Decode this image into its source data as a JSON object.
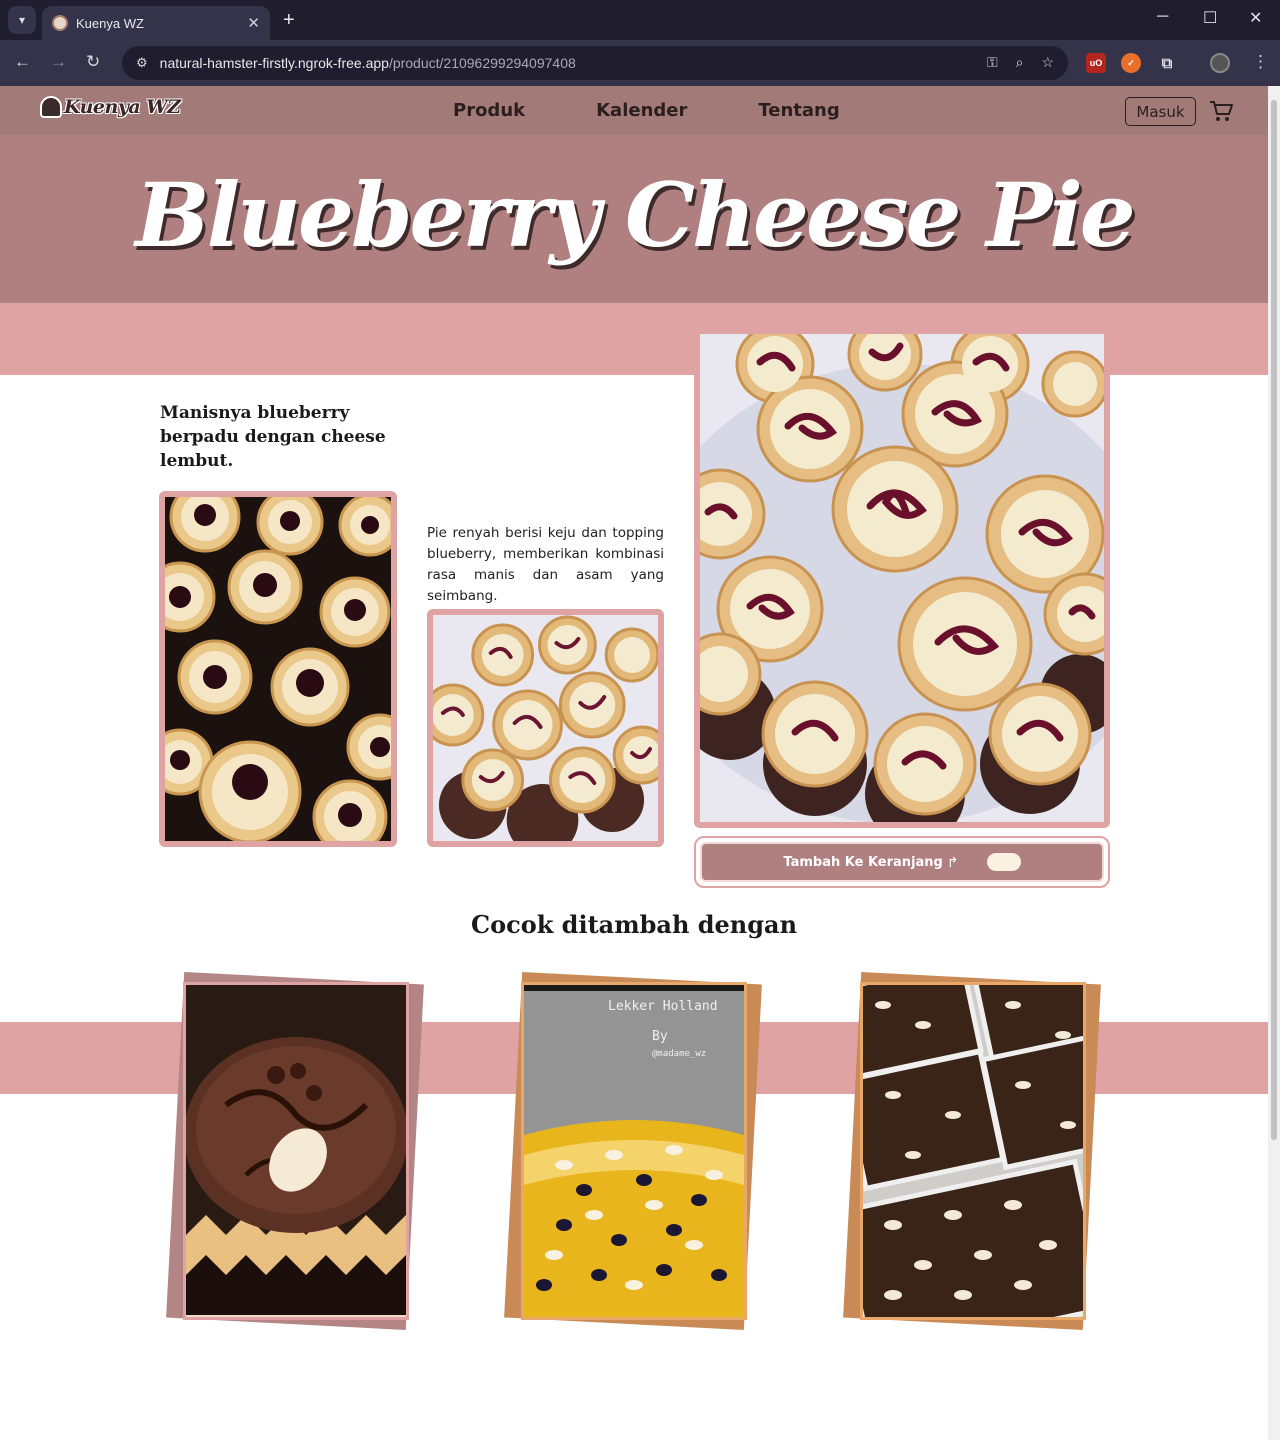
{
  "browser": {
    "tab_title": "Kuenya WZ",
    "url_host": "natural-hamster-firstly.ngrok-free.app",
    "url_path": "/product/21096299294097408",
    "new_tab_label": "+",
    "tab_close_label": "✕"
  },
  "site": {
    "logo_text": "Kuenya WZ",
    "nav": [
      "Produk",
      "Kalender",
      "Tentang"
    ],
    "login_label": "Masuk"
  },
  "product": {
    "name": "Blueberry Cheese Pie",
    "tagline": "Manisnya blueberry berpadu dengan cheese lembut.",
    "description": "Pie renyah berisi keju dan topping blueberry, memberikan kombinasi rasa manis dan asam yang seimbang.",
    "add_to_cart_label": "Tambah Ke Keranjang",
    "add_to_cart_icon": "arrow-icon"
  },
  "related": {
    "heading": "Cocok ditambah dengan",
    "watermark_title": "Lekker Holland",
    "watermark_by": "By",
    "watermark_handle": "@madame_wz"
  },
  "colors": {
    "header": "#a27a78",
    "hero": "#b07f7f",
    "accent_pink": "#dfa3a4",
    "card_orange": "#e8a86a"
  }
}
